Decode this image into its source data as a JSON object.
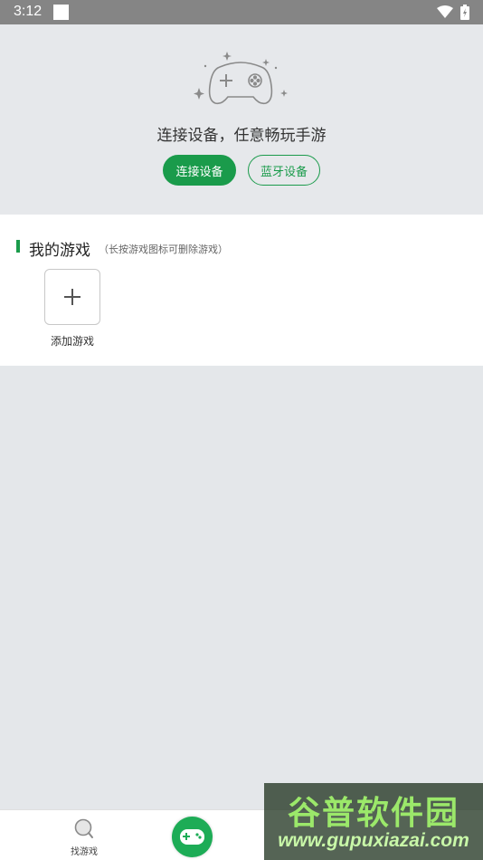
{
  "status_bar": {
    "time": "3:12"
  },
  "hero": {
    "tagline": "连接设备，任意畅玩手游",
    "connect_button": "连接设备",
    "bluetooth_button": "蓝牙设备",
    "accent_color": "#1a9b4b"
  },
  "my_games": {
    "title": "我的游戏",
    "hint": "（长按游戏图标可删除游戏）",
    "add_label": "添加游戏"
  },
  "tabbar": {
    "find_label": "找游戏"
  },
  "watermark": {
    "title": "谷普软件园",
    "url": "www.gupuxiazai.com"
  },
  "icons": {
    "status": [
      "notification-square-icon",
      "wifi-icon",
      "battery-icon"
    ],
    "hero": "gamepad-sparkle-icon",
    "add": "plus-icon",
    "tabs": [
      "search-icon",
      "gamepad-icon"
    ]
  }
}
